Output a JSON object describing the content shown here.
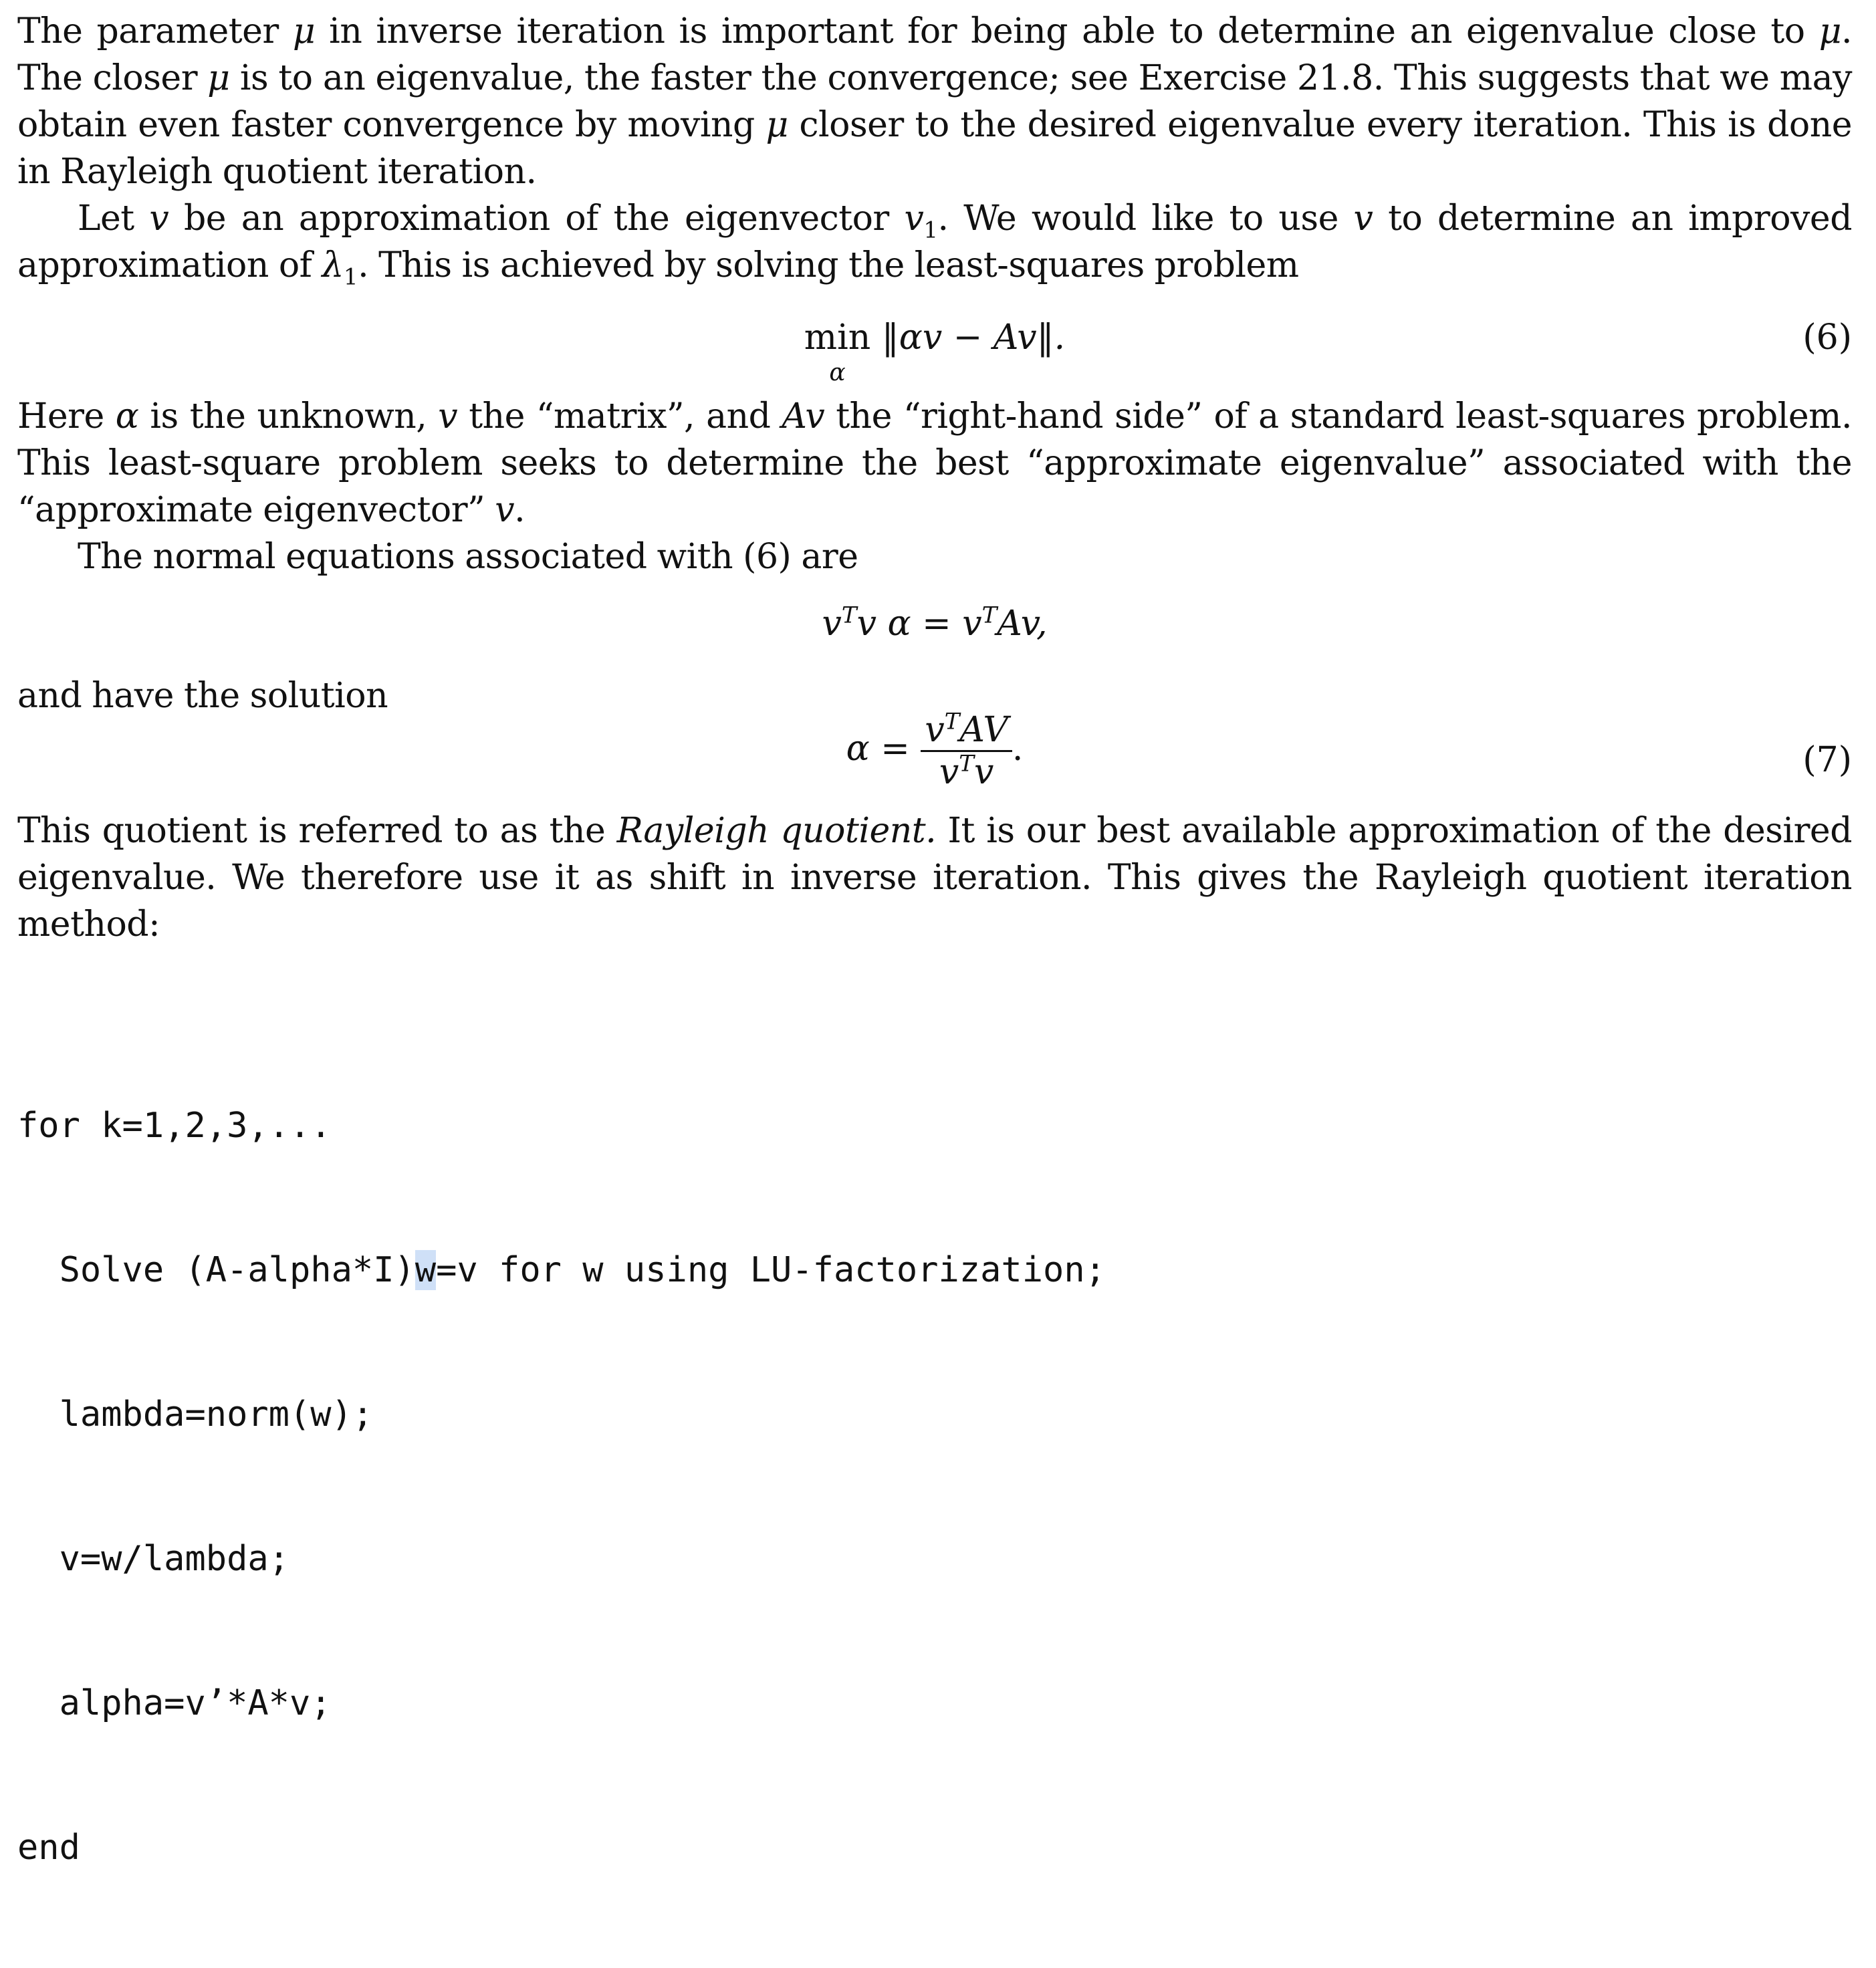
{
  "paragraphs": {
    "p1": {
      "t1": "The parameter ",
      "mu": "μ",
      "t2": " in inverse iteration is important for being able to determine an eigenvalue close to ",
      "t3": ". The closer ",
      "t4": " is to an eigenvalue, the faster the convergence; see Exercise 21.8. This suggests that we may obtain even faster convergence by moving ",
      "t5": " closer to the desired eigenvalue every iteration. This is done in Rayleigh quotient iteration."
    },
    "p2": {
      "t1": "Let ",
      "v": "v",
      "t2": " be an approximation of the eigenvector ",
      "v1_base": "v",
      "v1_sub": "1",
      "t3": ". We would like to use ",
      "t4": " to determine an improved approximation of ",
      "lambda_base": "λ",
      "lambda_sub": "1",
      "t5": ". This is achieved by solving the least-squares problem"
    },
    "p3": {
      "t1": "Here ",
      "alpha": "α",
      "t2": " is the unknown, ",
      "v": "v",
      "t3": " the “matrix”, and ",
      "av": "Av",
      "t4": " the “right-hand side” of a standard least-squares problem. This least-square problem seeks to determine the best “approximate eigenvalue” associated with the “approximate eigenvector” ",
      "t5": "."
    },
    "p4": {
      "t1": "The normal equations associated with (6) are"
    },
    "p5": {
      "t1": "and have the solution"
    },
    "p6": {
      "t1": "This quotient is referred to as the ",
      "em": "Rayleigh quotient.",
      "t2": " It is our best available approximation of the desired eigenvalue. We therefore use it as shift in inverse iteration. This gives the Rayleigh quotient iteration method:"
    }
  },
  "equations": {
    "eq6": {
      "op": "min",
      "sub": "α",
      "expr": "‖αv − Av‖.",
      "number": "(6)"
    },
    "normal": {
      "lhs_v": "v",
      "lhs_sup": "T",
      "lhs_rest": "v α = v",
      "rhs_sup": "T",
      "rhs_rest": "Av,"
    },
    "eq7": {
      "lhs": "α =",
      "num_v": "v",
      "num_sup": "T",
      "num_rest": "AV",
      "den_v": "v",
      "den_sup": "T",
      "den_rest": "v",
      "trail": ".",
      "number": "(7)"
    }
  },
  "code": {
    "line1": "for k=1,2,3,...",
    "line2_pre": "  Solve (A-alpha*I)",
    "line2_hl": "w",
    "line2_post": "=v for w using LU-factorization;",
    "line3": "  lambda=norm(w);",
    "line4": "  v=w/lambda;",
    "line5": "  alpha=v’*A*v;",
    "line6": "end"
  }
}
